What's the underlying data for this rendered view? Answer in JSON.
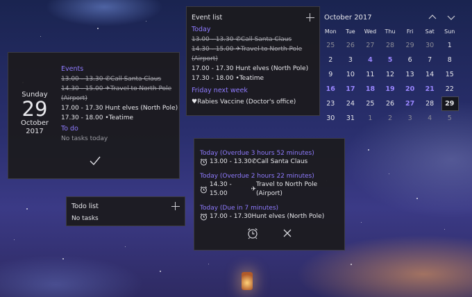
{
  "date_widget": {
    "weekday": "Sunday",
    "day": "29",
    "month": "October",
    "year": "2017",
    "events_title": "Events",
    "events": [
      {
        "time": "13.00 - 13.30",
        "glyph": "phone",
        "text": "Call Santa Claus",
        "done": true
      },
      {
        "time": "14.30 - 15.00",
        "glyph": "plane",
        "text": "Travel to North Pole",
        "cont": "(Airport)",
        "done": true
      },
      {
        "time": "17.00 - 17.30",
        "glyph": "",
        "text": "Hunt elves (North Pole)",
        "done": false
      },
      {
        "time": "17.30 - 18.00",
        "glyph": "drop",
        "text": "Teatime",
        "done": false
      }
    ],
    "todo_title": "To do",
    "todo_empty": "No tasks today",
    "confirm_icon": "checkmark-icon"
  },
  "event_list": {
    "title": "Event list",
    "today_label": "Today",
    "today_events": [
      {
        "time": "13.00 - 13.30",
        "glyph": "phone",
        "text": "Call Santa Claus",
        "done": true
      },
      {
        "time": "14.30 - 15.00",
        "glyph": "plane",
        "text": "Travel to North Pole",
        "cont": "(Airport)",
        "done": true
      },
      {
        "time": "17.00 - 17.30",
        "glyph": "",
        "text": "Hunt elves (North Pole)",
        "done": false
      },
      {
        "time": "17.30 - 18.00",
        "glyph": "drop",
        "text": "Teatime",
        "done": false
      }
    ],
    "next_label": "Friday next week",
    "next_events": [
      {
        "glyph": "heart",
        "text": "Rabies Vaccine (Doctor's office)"
      }
    ]
  },
  "calendar": {
    "month_label": "October 2017",
    "weekdays": [
      "Mon",
      "Tue",
      "Wed",
      "Thu",
      "Fri",
      "Sat",
      "Sun"
    ],
    "weeks": [
      [
        "25",
        "26",
        "27",
        "28",
        "29",
        "30",
        "1"
      ],
      [
        "2",
        "3",
        "4",
        "5",
        "6",
        "7",
        "8"
      ],
      [
        "9",
        "10",
        "11",
        "12",
        "13",
        "14",
        "15"
      ],
      [
        "16",
        "17",
        "18",
        "19",
        "20",
        "21",
        "22"
      ],
      [
        "23",
        "24",
        "25",
        "26",
        "27",
        "28",
        "29"
      ],
      [
        "30",
        "31",
        "1",
        "2",
        "3",
        "4",
        "5"
      ]
    ],
    "other_month": [
      [
        0,
        0
      ],
      [
        0,
        1
      ],
      [
        0,
        2
      ],
      [
        0,
        3
      ],
      [
        0,
        4
      ],
      [
        0,
        5
      ],
      [
        5,
        2
      ],
      [
        5,
        3
      ],
      [
        5,
        4
      ],
      [
        5,
        5
      ],
      [
        5,
        6
      ]
    ],
    "highlighted": [
      [
        1,
        2
      ],
      [
        1,
        3
      ],
      [
        3,
        0
      ],
      [
        3,
        1
      ],
      [
        3,
        2
      ],
      [
        3,
        3
      ],
      [
        3,
        4
      ],
      [
        3,
        5
      ],
      [
        4,
        4
      ]
    ],
    "today": [
      4,
      6
    ]
  },
  "reminder": {
    "items": [
      {
        "header": "Today (Overdue 3 hours 52 minutes)",
        "time": "13.00 - 13.30",
        "glyph": "phone",
        "text": "Call Santa Claus"
      },
      {
        "header": "Today (Overdue 2 hours 22 minutes)",
        "time": "14.30 - 15.00",
        "glyph": "plane",
        "text": "Travel to North Pole (Airport)"
      },
      {
        "header": "Today (Due in 7 minutes)",
        "time": "17.00 - 17.30",
        "glyph": "",
        "text": "Hunt elves (North Pole)"
      }
    ]
  },
  "todo_list": {
    "title": "Todo list",
    "empty": "No tasks"
  }
}
